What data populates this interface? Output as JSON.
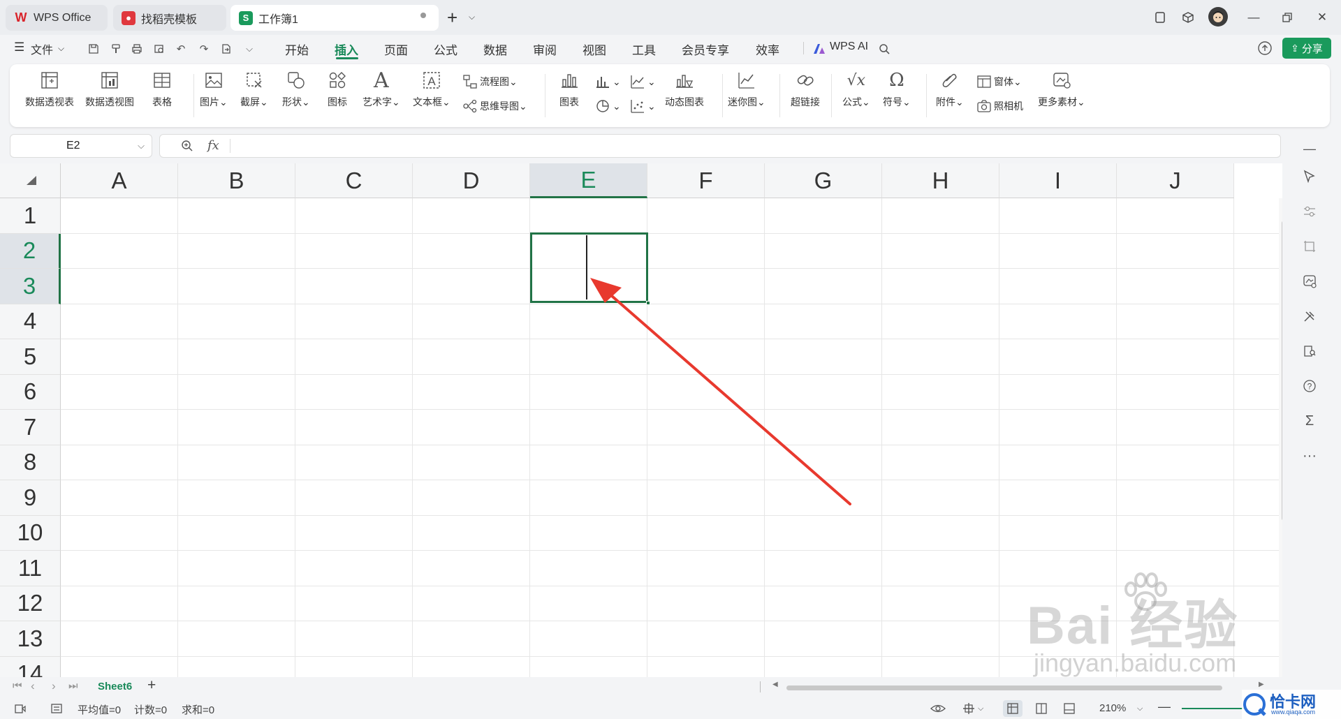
{
  "titlebar": {
    "tabs": [
      {
        "label": "WPS Office",
        "icon": "wps-logo-icon"
      },
      {
        "label": "找稻壳模板",
        "icon": "docer-icon"
      },
      {
        "label": "工作簿1",
        "icon": "spreadsheet-s-icon",
        "icon_letter": "S",
        "active": true
      }
    ],
    "new_tab": "+"
  },
  "menubar": {
    "file": "文件",
    "items": [
      "开始",
      "插入",
      "页面",
      "公式",
      "数据",
      "审阅",
      "视图",
      "工具",
      "会员专享",
      "效率"
    ],
    "active": "插入",
    "wps_ai": "WPS AI",
    "share": "分享"
  },
  "ribbon": {
    "pivot_table": "数据透视表",
    "pivot_chart": "数据透视图",
    "table": "表格",
    "picture": "图片",
    "screenshot": "截屏",
    "shape": "形状",
    "icon": "图标",
    "wordart": "艺术字",
    "textbox": "文本框",
    "flowchart": "流程图",
    "mindmap": "思维导图",
    "chart": "图表",
    "dynamic_chart": "动态图表",
    "sparkline": "迷你图",
    "hyperlink": "超链接",
    "formula": "公式",
    "symbol": "符号",
    "attachment": "附件",
    "window": "窗体",
    "camera": "照相机",
    "more": "更多素材"
  },
  "formula_bar": {
    "cell_ref": "E2",
    "fx": "fx",
    "value": ""
  },
  "grid": {
    "columns": [
      "A",
      "B",
      "C",
      "D",
      "E",
      "F",
      "G",
      "H",
      "I",
      "J"
    ],
    "rows": [
      "1",
      "2",
      "3",
      "4",
      "5",
      "6",
      "7",
      "8",
      "9",
      "10",
      "11",
      "12",
      "13",
      "14"
    ],
    "selected_cell": "E2",
    "selected_column": "E",
    "selected_rows": [
      "2",
      "3"
    ]
  },
  "sheets": {
    "tabs": [
      "Sheet6"
    ],
    "add": "+"
  },
  "statusbar": {
    "average": "平均值=0",
    "count": "计数=0",
    "sum": "求和=0",
    "zoom": "210%"
  },
  "watermark": {
    "baidu": "Bai 经验",
    "baidu_url": "jingyan.baidu.com",
    "site": "恰卡网",
    "site_url": "www.qiaqa.com"
  },
  "colors": {
    "accent": "#1a8a5a",
    "selection": "#217346",
    "arrow": "#e8392e",
    "active_tab": "#ffffff"
  }
}
